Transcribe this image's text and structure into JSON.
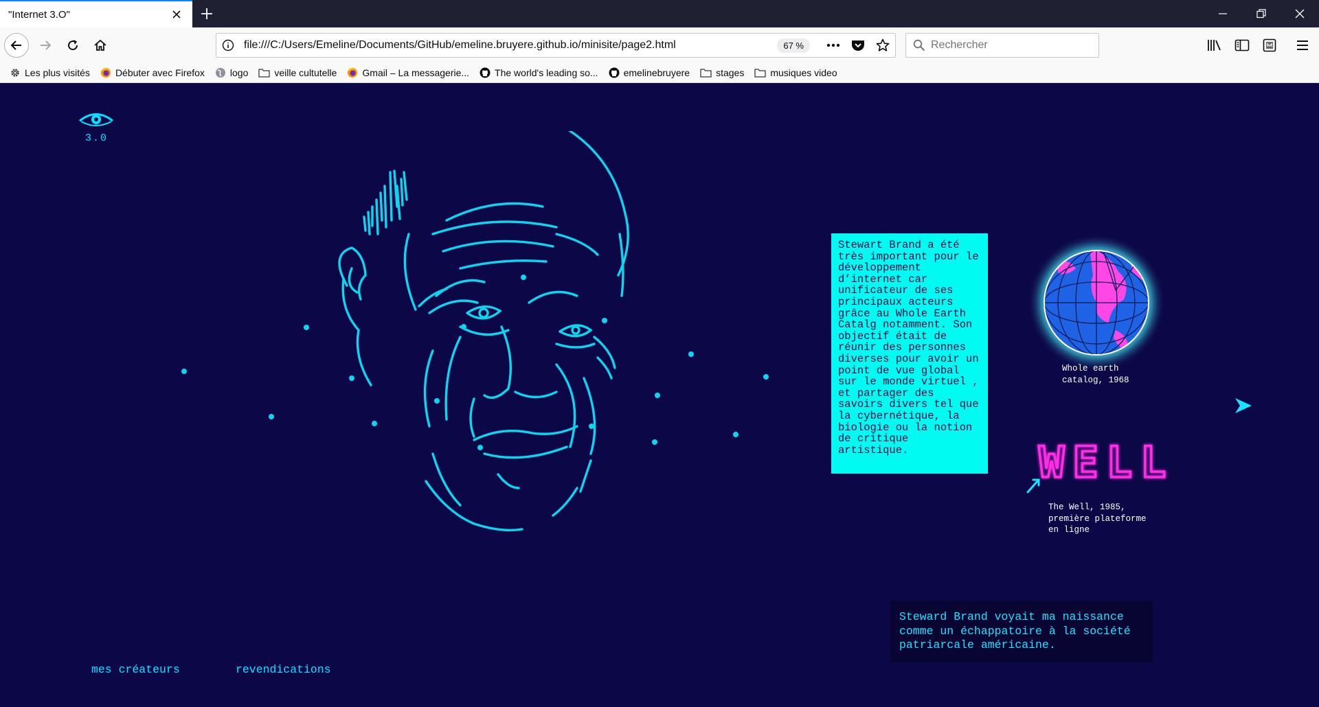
{
  "browser": {
    "tab_title": "\"Internet 3.O\"",
    "url": "file:///C:/Users/Emeline/Documents/GitHub/emeline.bruyere.github.io/minisite/page2.html",
    "zoom": "67 %",
    "search_placeholder": "Rechercher",
    "bookmarks": [
      {
        "label": "Les plus visités",
        "icon": "gear-icon"
      },
      {
        "label": "Débuter avec Firefox",
        "icon": "firefox-icon"
      },
      {
        "label": "logo",
        "icon": "globe-icon"
      },
      {
        "label": "veille cultutelle",
        "icon": "folder-icon"
      },
      {
        "label": "Gmail – La messagerie...",
        "icon": "firefox-icon"
      },
      {
        "label": "The world's leading so...",
        "icon": "github-icon"
      },
      {
        "label": "emelinebruyere",
        "icon": "github-icon"
      },
      {
        "label": "stages",
        "icon": "folder-icon"
      },
      {
        "label": "musiques video",
        "icon": "folder-icon"
      }
    ]
  },
  "page": {
    "logo_text": "3.0",
    "info_text": "Stewart Brand a été très important pour le développement d’internet car unificateur de ses principaux acteurs grâce au Whole Earth Catalg notamment. Son objectif était de réunir des personnes diverses pour avoir un point de vue global sur le monde virtuel , et partager des savoirs divers tel que la cybernétique, la biologie ou la notion de critique artistique.",
    "globe_caption": "Whole earth\ncatalog, 1968",
    "well_logo": "WELL",
    "well_caption": "The Well, 1985,\npremière plateforme\nen ligne",
    "quote": "Steward Brand voyait ma naissance comme un échappatoire à la société patriarcale américaine.",
    "nav_links": [
      "mes créateurs",
      "revendications"
    ],
    "colors": {
      "background": "#0c0848",
      "cyan": "#00e5ff",
      "info_box": "#00fbf2",
      "magenta": "#ff2ee6"
    }
  }
}
